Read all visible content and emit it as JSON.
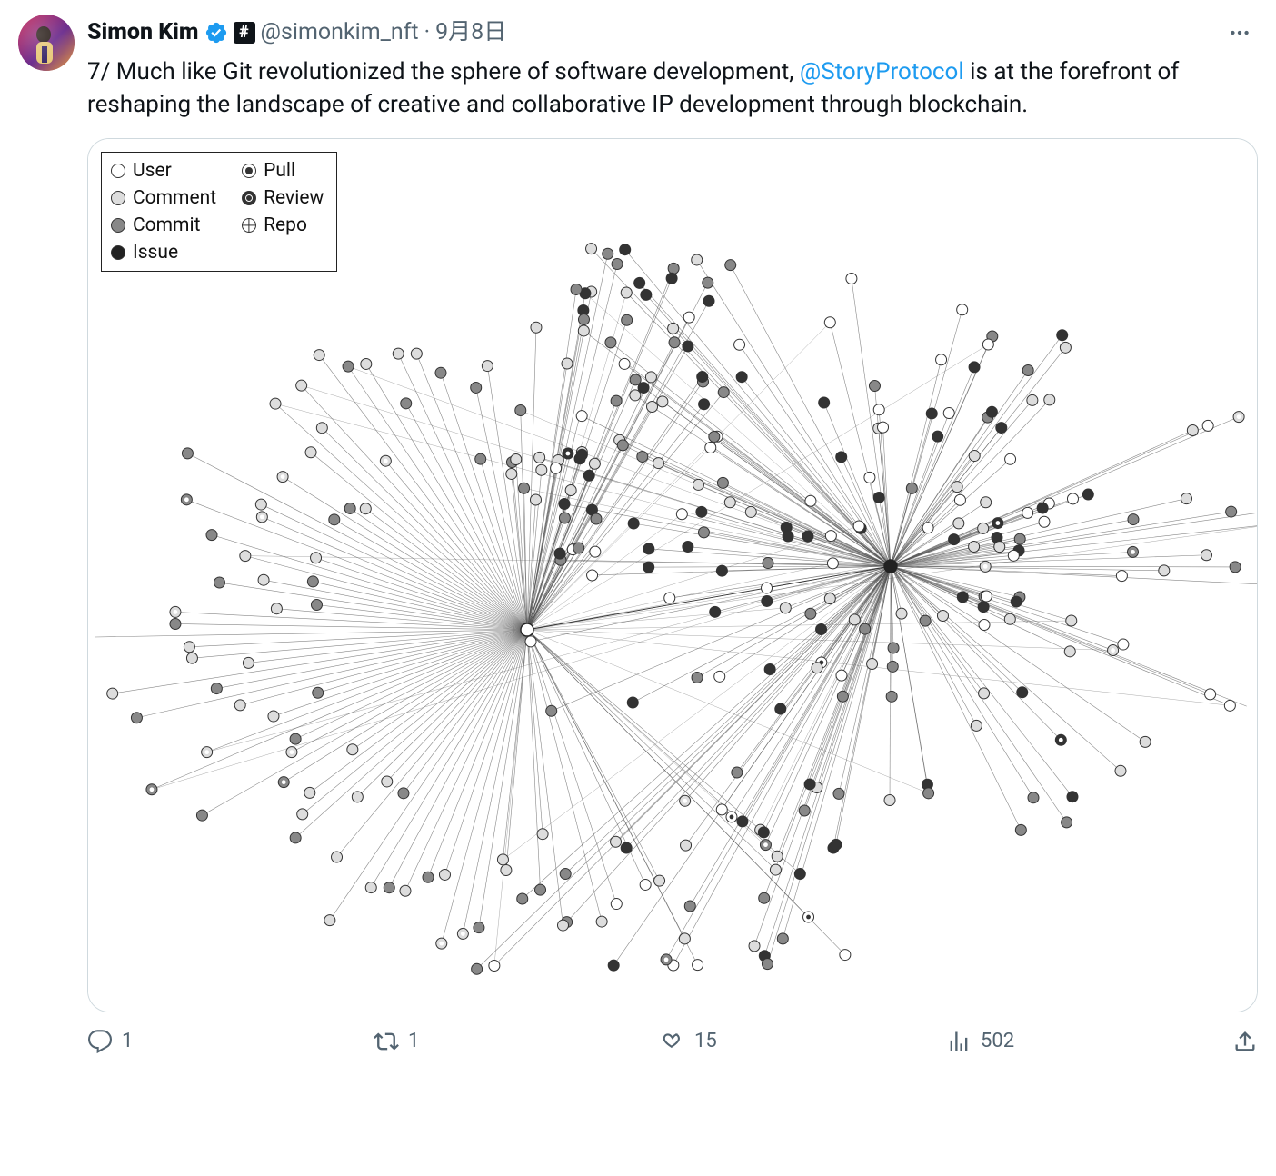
{
  "tweet": {
    "author": {
      "display_name": "Simon Kim",
      "handle": "@simonkim_nft",
      "verified": true,
      "hash_badge": "#"
    },
    "separator": "·",
    "date": "9月8日",
    "text_parts": {
      "p1": "7/ Much like Git revolutionized the sphere of software development, ",
      "mention": "@StoryProtocol",
      "p2": " is at the forefront of reshaping the landscape of creative and collaborative IP development through blockchain."
    },
    "legend": {
      "user": "User",
      "comment": "Comment",
      "commit": "Commit",
      "issue": "Issue",
      "pull": "Pull",
      "review": "Review",
      "repo": "Repo"
    },
    "actions": {
      "replies": "1",
      "retweets": "1",
      "likes": "15",
      "views": "502"
    }
  }
}
